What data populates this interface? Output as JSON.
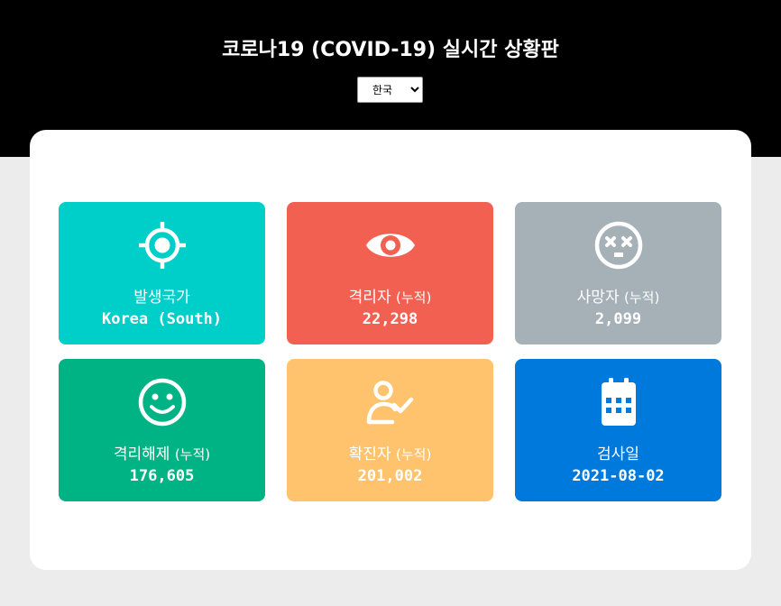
{
  "header": {
    "title": "코로나19 (COVID-19)  실시간 상황판",
    "country_select": {
      "selected": "한국",
      "options": [
        "한국"
      ]
    }
  },
  "cards": [
    {
      "label": "발생국가",
      "suffix": "",
      "value": "Korea (South)",
      "color": "#00cec9",
      "icon": "crosshair-icon"
    },
    {
      "label": "격리자",
      "suffix": "(누적)",
      "value": "22,298",
      "color": "#f26052",
      "icon": "eye-icon"
    },
    {
      "label": "사망자",
      "suffix": "(누적)",
      "value": "2,099",
      "color": "#a5b1b7",
      "icon": "dizzy-face-icon"
    },
    {
      "label": "격리해제",
      "suffix": "(누적)",
      "value": "176,605",
      "color": "#00b385",
      "icon": "smile-face-icon"
    },
    {
      "label": "확진자",
      "suffix": "(누적)",
      "value": "201,002",
      "color": "#ffc36e",
      "icon": "user-check-icon"
    },
    {
      "label": "검사일",
      "suffix": "",
      "value": "2021-08-02",
      "color": "#0079dd",
      "icon": "calendar-icon"
    }
  ]
}
